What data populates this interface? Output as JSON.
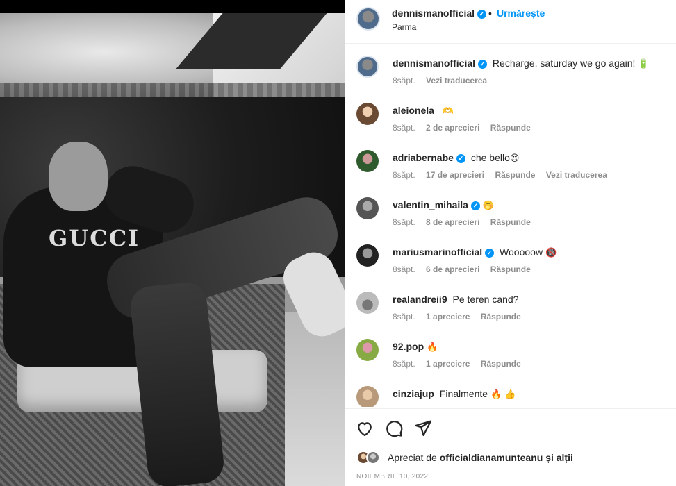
{
  "post": {
    "username": "dennismanofficial",
    "dot": "•",
    "follow_label": "Urmărește",
    "location": "Parma",
    "image_text": "GUCCI"
  },
  "comments": [
    {
      "user": "dennismanofficial",
      "verified": true,
      "text": "Recharge, saturday we go again!",
      "emoji": "🔋",
      "time": "8săpt.",
      "likes": "",
      "reply": "",
      "translate": "Vezi traducerea"
    },
    {
      "user": "aleionela_",
      "verified": false,
      "text": "",
      "emoji": "🫶",
      "time": "8săpt.",
      "likes": "2 de aprecieri",
      "reply": "Răspunde",
      "translate": ""
    },
    {
      "user": "adriabernabe",
      "verified": true,
      "text": "che bello",
      "emoji": "😍",
      "time": "8săpt.",
      "likes": "17 de aprecieri",
      "reply": "Răspunde",
      "translate": "Vezi traducerea"
    },
    {
      "user": "valentin_mihaila",
      "verified": true,
      "text": "",
      "emoji": "🤭",
      "time": "8săpt.",
      "likes": "8 de aprecieri",
      "reply": "Răspunde",
      "translate": ""
    },
    {
      "user": "mariusmarinofficial",
      "verified": true,
      "text": "Wooooow",
      "emoji": "🔞",
      "time": "8săpt.",
      "likes": "6 de aprecieri",
      "reply": "Răspunde",
      "translate": ""
    },
    {
      "user": "realandreii9",
      "verified": false,
      "text": "Pe teren cand?",
      "emoji": "",
      "time": "8săpt.",
      "likes": "1 apreciere",
      "reply": "Răspunde",
      "translate": ""
    },
    {
      "user": "92.pop",
      "verified": false,
      "text": "",
      "emoji": "🔥",
      "time": "8săpt.",
      "likes": "1 apreciere",
      "reply": "Răspunde",
      "translate": ""
    },
    {
      "user": "cinziajup",
      "verified": false,
      "text": "Finalmente",
      "emoji": "🔥 👍",
      "time": "",
      "likes": "",
      "reply": "",
      "translate": ""
    }
  ],
  "footer": {
    "liked_prefix": "Apreciat de",
    "liked_user": "officialdianamunteanu",
    "liked_suffix": "și alții",
    "date": "NOIEMBRIE 10, 2022"
  },
  "icons": {
    "like": "heart-icon",
    "comment": "comment-bubble-icon",
    "share": "paper-plane-icon",
    "verified": "verified-badge-icon"
  },
  "colors": {
    "accent": "#0095f6",
    "muted": "#8e8e8e",
    "text": "#262626"
  }
}
